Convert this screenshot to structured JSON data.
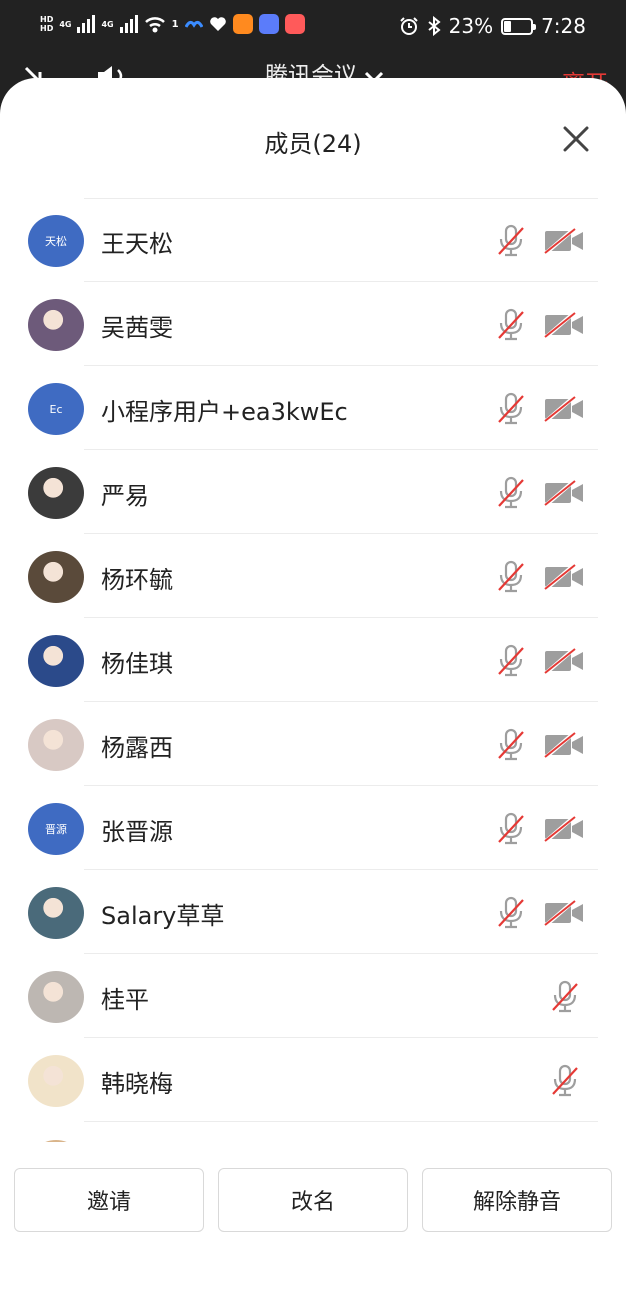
{
  "status_bar": {
    "hd1": "HD",
    "hd2": "HD",
    "net1": "4G",
    "net2": "4G",
    "wifi_count": "1",
    "battery_pct": "23%",
    "time": "7:28",
    "battery_level": 0.23
  },
  "meeting": {
    "title": "腾讯会议",
    "leave": "离开"
  },
  "panel": {
    "title": "成员(24)"
  },
  "members": [
    {
      "name": "王天松",
      "avatar_text": "天松",
      "avatar_kind": "text",
      "mic_muted": true,
      "cam_off": true
    },
    {
      "name": "吴茜雯",
      "avatar_kind": "photo",
      "mic_muted": true,
      "cam_off": true
    },
    {
      "name": "小程序用户+ea3kwEc",
      "avatar_text": "Ec",
      "avatar_kind": "text",
      "mic_muted": true,
      "cam_off": true
    },
    {
      "name": "严易",
      "avatar_kind": "photo",
      "mic_muted": true,
      "cam_off": true
    },
    {
      "name": "杨环毓",
      "avatar_kind": "photo",
      "mic_muted": true,
      "cam_off": true
    },
    {
      "name": "杨佳琪",
      "avatar_kind": "photo",
      "mic_muted": true,
      "cam_off": true
    },
    {
      "name": "杨露西",
      "avatar_kind": "photo",
      "mic_muted": true,
      "cam_off": true
    },
    {
      "name": "张晋源",
      "avatar_text": "晋源",
      "avatar_kind": "text",
      "mic_muted": true,
      "cam_off": true
    },
    {
      "name": " Salary草草",
      "avatar_kind": "photo",
      "mic_muted": true,
      "cam_off": true
    },
    {
      "name": "桂平",
      "avatar_kind": "photo",
      "mic_muted": true,
      "cam_off": false
    },
    {
      "name": "韩晓梅",
      "avatar_kind": "photo",
      "mic_muted": true,
      "cam_off": false
    }
  ],
  "buttons": {
    "invite": "邀请",
    "rename": "改名",
    "unmute": "解除静音"
  },
  "colors": {
    "accent_blue": "#3f6bc2",
    "muted_red": "#e53935",
    "icon_gray": "#9e9e9e",
    "leave_red": "#e53935"
  }
}
